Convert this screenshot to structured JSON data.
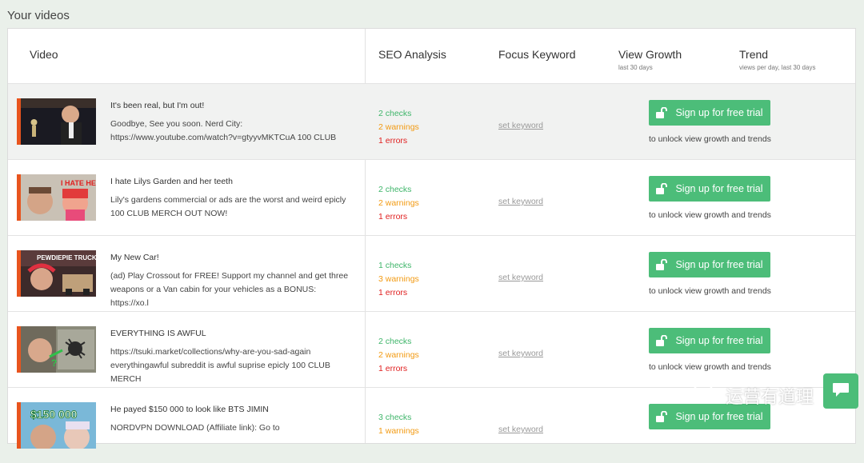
{
  "page_title": "Your videos",
  "columns": {
    "video": "Video",
    "seo": "SEO Analysis",
    "focus_keyword": "Focus Keyword",
    "view_growth": "View Growth",
    "view_growth_sub": "last 30 days",
    "trend": "Trend",
    "trend_sub": "views per day, last 30 days"
  },
  "videos": [
    {
      "title": "It's been real, but I'm out!",
      "description": "Goodbye, See you soon. Nerd City: https://www.youtube.com/watch?v=gtyyvMKTCuA 100 CLUB",
      "checks": "2 checks",
      "warnings": "2 warnings",
      "errors": "1 errors",
      "keyword_link": "set keyword",
      "button_label": "Sign up for free trial",
      "unlock_note": "to unlock view growth and trends",
      "thumb_text": ""
    },
    {
      "title": "I hate Lilys Garden and her teeth",
      "description": "Lily's gardens commercial or ads are the worst and weird epicly 100 CLUB MERCH OUT NOW!",
      "checks": "2 checks",
      "warnings": "2 warnings",
      "errors": "1 errors",
      "keyword_link": "set keyword",
      "button_label": "Sign up for free trial",
      "unlock_note": "to unlock view growth and trends",
      "thumb_text": "I HATE HER"
    },
    {
      "title": "My New Car!",
      "description": "(ad) Play Crossout for FREE! Support my channel and get three weapons or a Van cabin for your vehicles as a BONUS: https://xo.l",
      "checks": "1 checks",
      "warnings": "3 warnings",
      "errors": "1 errors",
      "keyword_link": "set keyword",
      "button_label": "Sign up for free trial",
      "unlock_note": "to unlock view growth and trends",
      "thumb_text": "PEWDIEPIE TRUCK"
    },
    {
      "title": "EVERYTHING IS AWFUL",
      "description": "https://tsuki.market/collections/why-are-you-sad-again everythingawful subreddit is awful suprise epicly 100 CLUB MERCH",
      "checks": "2 checks",
      "warnings": "2 warnings",
      "errors": "1 errors",
      "keyword_link": "set keyword",
      "button_label": "Sign up for free trial",
      "unlock_note": "to unlock view growth and trends",
      "thumb_text": ""
    },
    {
      "title": "He payed $150 000 to look like BTS JIMIN",
      "description": "NORDVPN DOWNLOAD (Affiliate link): Go to",
      "checks": "3 checks",
      "warnings": "1 warnings",
      "errors": "",
      "keyword_link": "set keyword",
      "button_label": "Sign up for free trial",
      "unlock_note": "",
      "thumb_text": "$150 000"
    }
  ],
  "watermark": "运营有道理",
  "colors": {
    "accent_green": "#4cbd79",
    "checks": "#3fb56a",
    "warnings": "#f29a12",
    "errors": "#e02020",
    "thumb_accent": "#e8541e"
  },
  "icons": {
    "button": "unlock-icon",
    "chat": "chat-icon",
    "watermark": "wechat-icon"
  }
}
